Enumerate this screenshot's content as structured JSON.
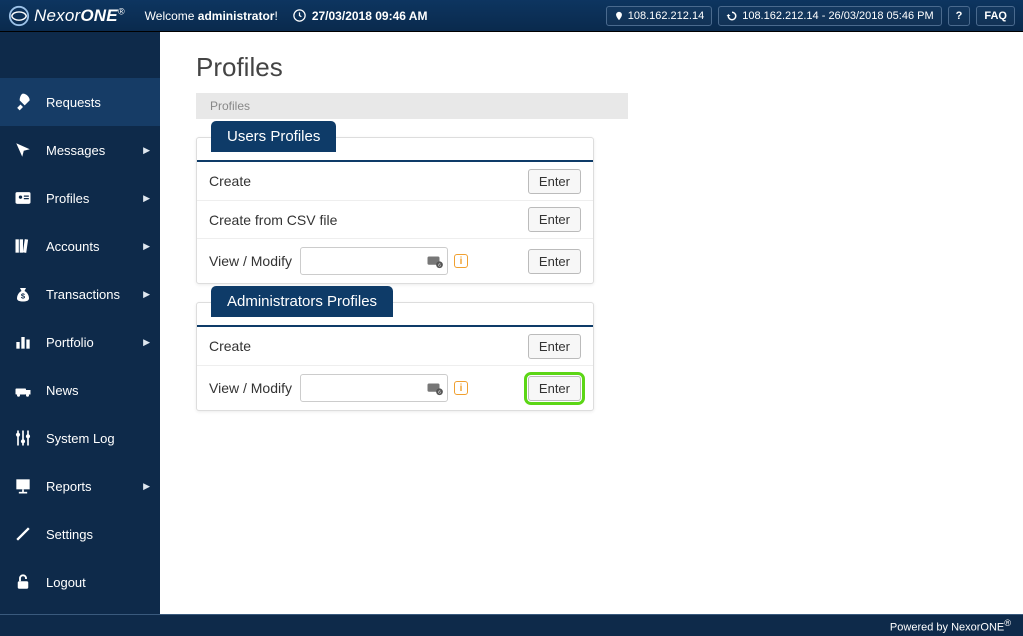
{
  "header": {
    "logo_nexor": "Nexor",
    "logo_one": "ONE",
    "logo_reg": "®",
    "welcome_prefix": "Welcome ",
    "welcome_user": "administrator",
    "welcome_suffix": "!",
    "datetime": "27/03/2018 09:46 AM",
    "ip_current": "108.162.212.14",
    "ip_history": "108.162.212.14 - 26/03/2018 05:46 PM",
    "help_label": "?",
    "faq_label": "FAQ"
  },
  "sidebar": {
    "items": [
      {
        "label": "Requests",
        "icon": "rocket",
        "active": true,
        "arrow": false
      },
      {
        "label": "Messages",
        "icon": "cursor",
        "active": false,
        "arrow": true
      },
      {
        "label": "Profiles",
        "icon": "id-card",
        "active": false,
        "arrow": true
      },
      {
        "label": "Accounts",
        "icon": "books",
        "active": false,
        "arrow": true
      },
      {
        "label": "Transactions",
        "icon": "bag",
        "active": false,
        "arrow": true
      },
      {
        "label": "Portfolio",
        "icon": "bars",
        "active": false,
        "arrow": true
      },
      {
        "label": "News",
        "icon": "truck",
        "active": false,
        "arrow": false
      },
      {
        "label": "System Log",
        "icon": "sliders",
        "active": false,
        "arrow": false
      },
      {
        "label": "Reports",
        "icon": "presentation",
        "active": false,
        "arrow": true
      },
      {
        "label": "Settings",
        "icon": "tools",
        "active": false,
        "arrow": false
      },
      {
        "label": "Logout",
        "icon": "lock",
        "active": false,
        "arrow": false
      }
    ]
  },
  "page": {
    "title": "Profiles",
    "breadcrumb": "Profiles"
  },
  "panels": {
    "users": {
      "title": "Users Profiles",
      "rows": {
        "create": {
          "label": "Create",
          "button": "Enter"
        },
        "csv": {
          "label": "Create from CSV file",
          "button": "Enter"
        },
        "view": {
          "label": "View / Modify",
          "button": "Enter",
          "input_value": ""
        }
      }
    },
    "admins": {
      "title": "Administrators Profiles",
      "rows": {
        "create": {
          "label": "Create",
          "button": "Enter"
        },
        "view": {
          "label": "View / Modify",
          "button": "Enter",
          "input_value": ""
        }
      }
    }
  },
  "footer": {
    "text_prefix": "Powered by NexorONE",
    "reg": "®"
  }
}
